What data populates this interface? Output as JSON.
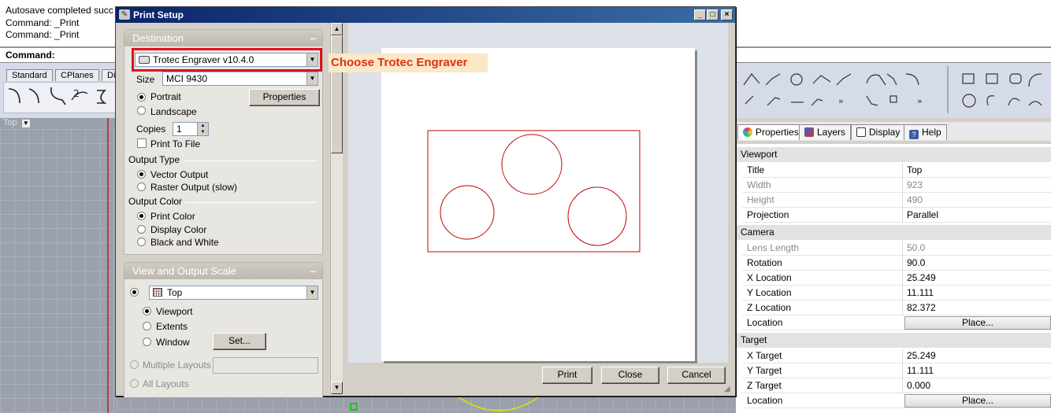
{
  "command_history": [
    "Autosave completed succ",
    "Command: _Print",
    "Command: _Print"
  ],
  "command_prompt": "Command:",
  "toolbar_tabs": [
    "Standard",
    "CPlanes",
    "Di"
  ],
  "viewport_label": "Top",
  "panel_tabs": [
    "Properties",
    "Layers",
    "Display",
    "Help"
  ],
  "properties": {
    "viewport_section": "Viewport",
    "viewport_rows": [
      {
        "key": "Title",
        "value": "Top",
        "disabled": false
      },
      {
        "key": "Width",
        "value": "923",
        "disabled": true
      },
      {
        "key": "Height",
        "value": "490",
        "disabled": true
      },
      {
        "key": "Projection",
        "value": "Parallel",
        "disabled": false
      }
    ],
    "camera_section": "Camera",
    "camera_rows": [
      {
        "key": "Lens Length",
        "value": "50.0",
        "disabled": true
      },
      {
        "key": "Rotation",
        "value": "90.0",
        "disabled": false
      },
      {
        "key": "X Location",
        "value": "25.249",
        "disabled": false
      },
      {
        "key": "Y Location",
        "value": "11.111",
        "disabled": false
      },
      {
        "key": "Z Location",
        "value": "82.372",
        "disabled": false
      }
    ],
    "camera_location_label": "Location",
    "place_button": "Place...",
    "target_section": "Target",
    "target_rows": [
      {
        "key": "X Target",
        "value": "25.249",
        "disabled": false
      },
      {
        "key": "Y Target",
        "value": "11.111",
        "disabled": false
      },
      {
        "key": "Z Target",
        "value": "0.000",
        "disabled": false
      }
    ],
    "target_location_label": "Location"
  },
  "dialog": {
    "title": "Print Setup",
    "destination": {
      "header": "Destination",
      "printer": "Trotec Engraver v10.4.0",
      "size_label": "Size",
      "size_value": "MCI 9430",
      "portrait": "Portrait",
      "landscape": "Landscape",
      "properties_button": "Properties",
      "copies_label": "Copies",
      "copies_value": "1",
      "print_to_file": "Print To File",
      "output_type_header": "Output Type",
      "vector_output": "Vector Output",
      "raster_output": "Raster Output (slow)",
      "output_color_header": "Output Color",
      "print_color": "Print Color",
      "display_color": "Display Color",
      "black_white": "Black and White"
    },
    "view_scale": {
      "header": "View and Output Scale",
      "view_value": "Top",
      "viewport": "Viewport",
      "extents": "Extents",
      "window": "Window",
      "set_button": "Set...",
      "multiple_layouts": "Multiple Layouts",
      "all_layouts": "All Layouts"
    },
    "print_button": "Print",
    "close_button": "Close",
    "cancel_button": "Cancel"
  },
  "annotation": "Choose Trotec Engraver",
  "colors": {
    "title_bar": "#0a246a",
    "annotation_text": "#e03010",
    "highlight_border": "#e01020",
    "drawing_stroke": "#c00000"
  }
}
